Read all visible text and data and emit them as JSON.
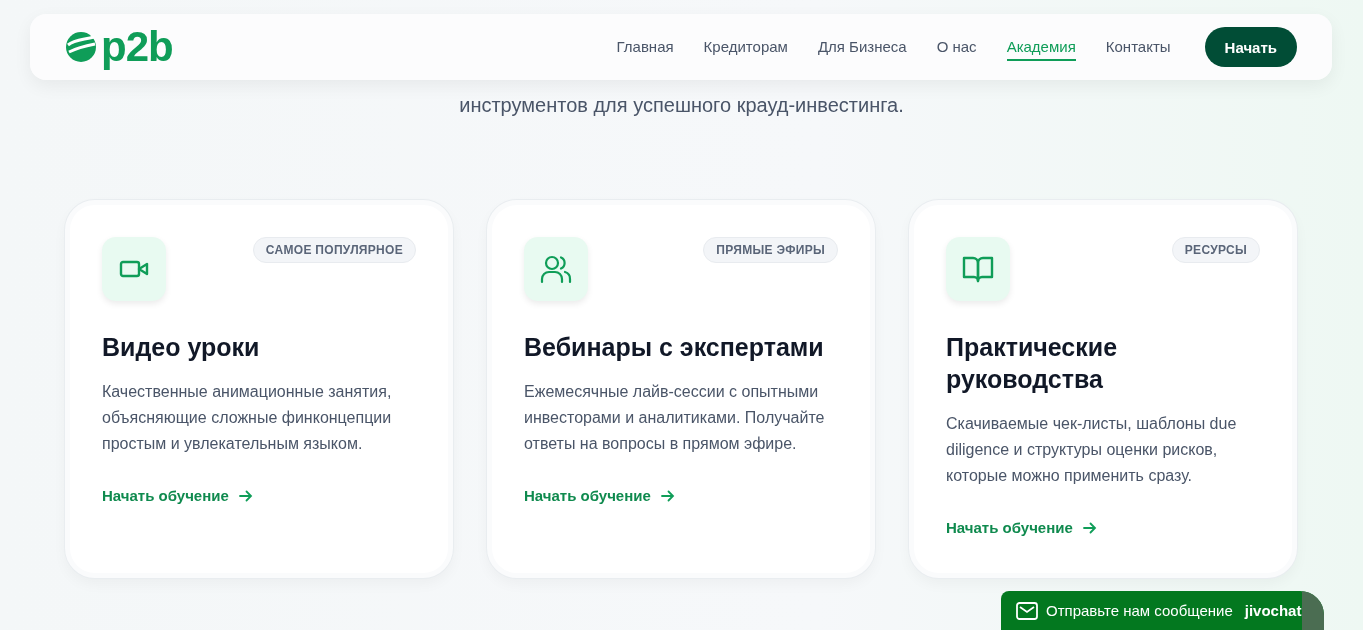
{
  "nav": {
    "logo": "p2b",
    "items": [
      {
        "label": "Главная",
        "selected": false
      },
      {
        "label": "Кредиторам",
        "selected": false
      },
      {
        "label": "Для Бизнеса",
        "selected": false
      },
      {
        "label": "О нас",
        "selected": false
      },
      {
        "label": "Академия",
        "selected": true
      },
      {
        "label": "Контакты",
        "selected": false
      }
    ],
    "cta": "Начать"
  },
  "hero": {
    "subtitle": "инструментов для успешного крауд-инвестинга."
  },
  "cards": [
    {
      "badge": "САМОЕ ПОПУЛЯРНОЕ",
      "title": "Видео уроки",
      "text": "Качественные анимационные занятия, объясняющие сложные финконцепции простым и увлекательным языком.",
      "link": "Начать обучение"
    },
    {
      "badge": "ПРЯМЫЕ ЭФИРЫ",
      "title": "Вебинары с экспертами",
      "text": "Ежемесячные лайв-сессии с опытными инвесторами и аналитиками. Получайте ответы на вопросы в прямом эфире.",
      "link": "Начать обучение"
    },
    {
      "badge": "РЕСУРСЫ",
      "title": "Практические руководства",
      "text": "Скачиваемые чек-листы, шаблоны due diligence и структуры оценки рисков, которые можно применить сразу.",
      "link": "Начать обучение"
    }
  ],
  "chat": {
    "label": "Отправьте нам сообщение",
    "brand": "jivochat"
  }
}
